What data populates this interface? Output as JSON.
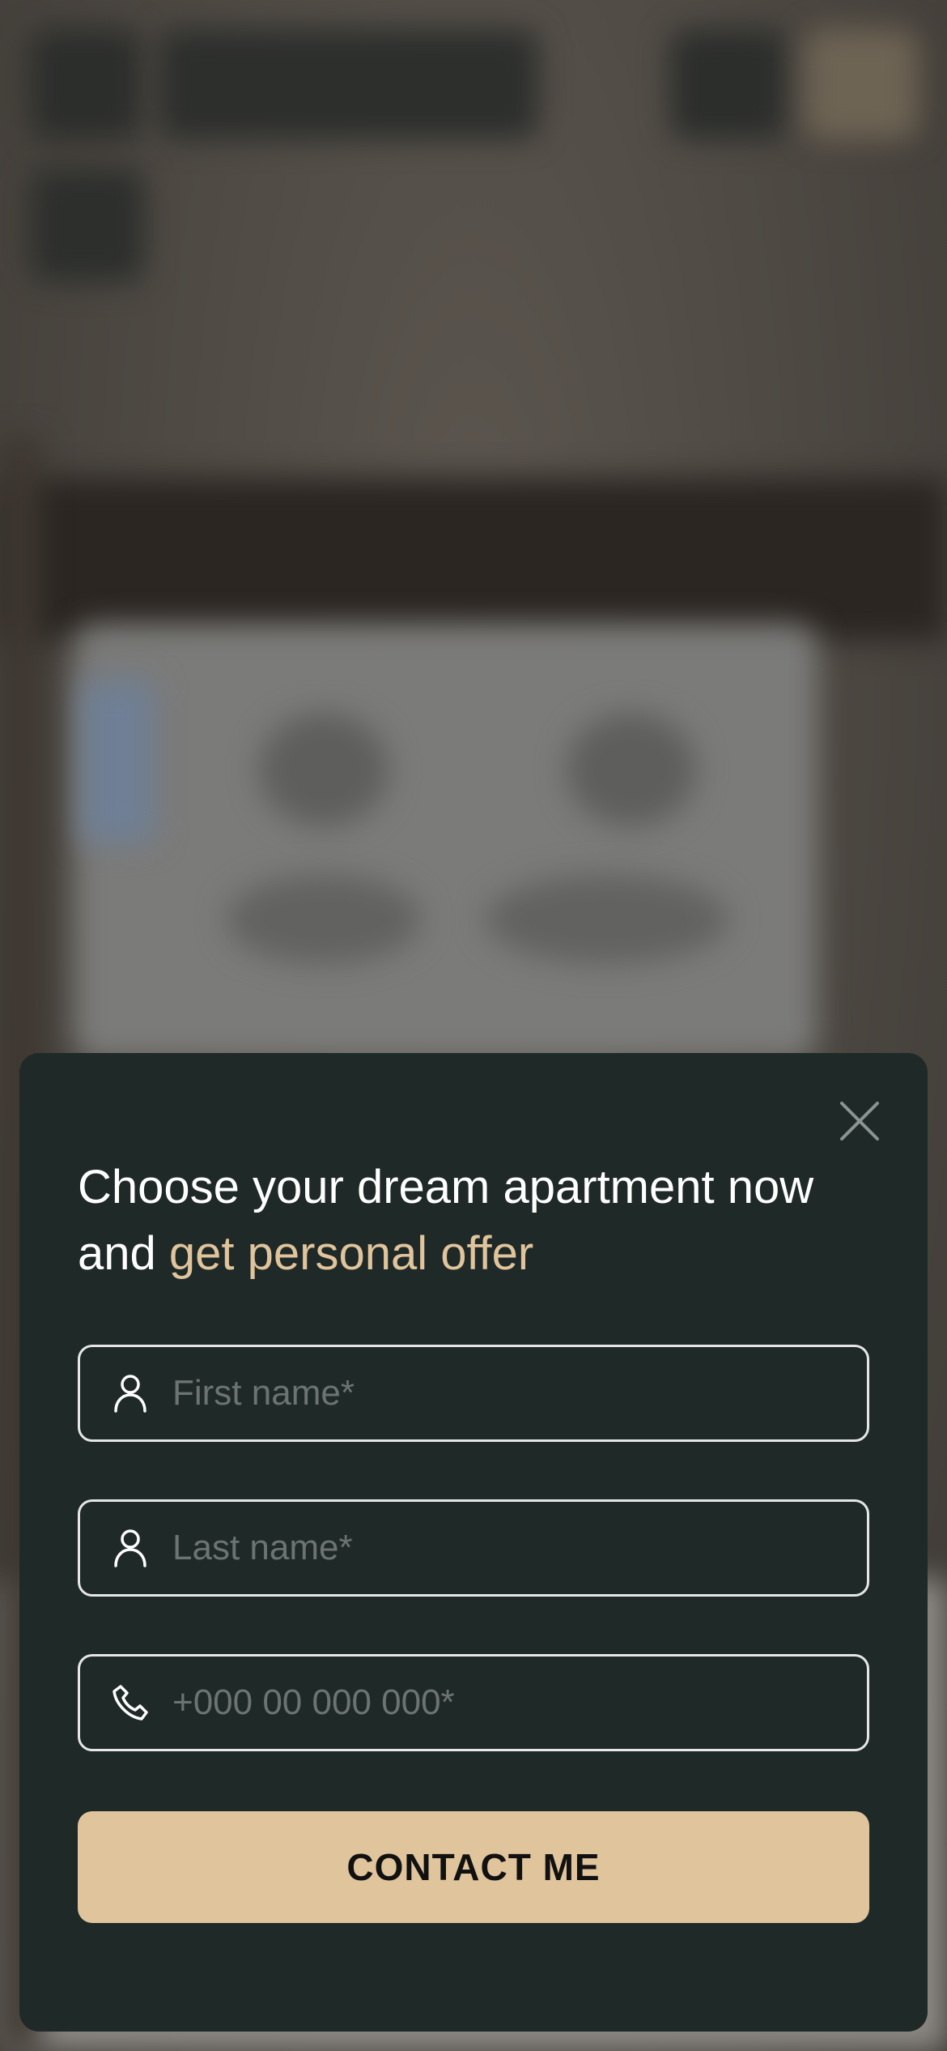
{
  "modal": {
    "title_main": "Choose your dream apartment now and ",
    "title_accent": "get personal offer",
    "close_icon": "close-icon",
    "accent_color": "#e0c49c",
    "background_color": "#1f2928"
  },
  "form": {
    "first_name": {
      "placeholder": "First name*",
      "value": "",
      "icon": "user-icon"
    },
    "last_name": {
      "placeholder": "Last name*",
      "value": "",
      "icon": "user-icon"
    },
    "phone": {
      "placeholder": "+000 00 000 000*",
      "value": "",
      "icon": "phone-icon"
    },
    "submit_label": "CONTACT ME",
    "submit_color": "#dfc49c"
  }
}
